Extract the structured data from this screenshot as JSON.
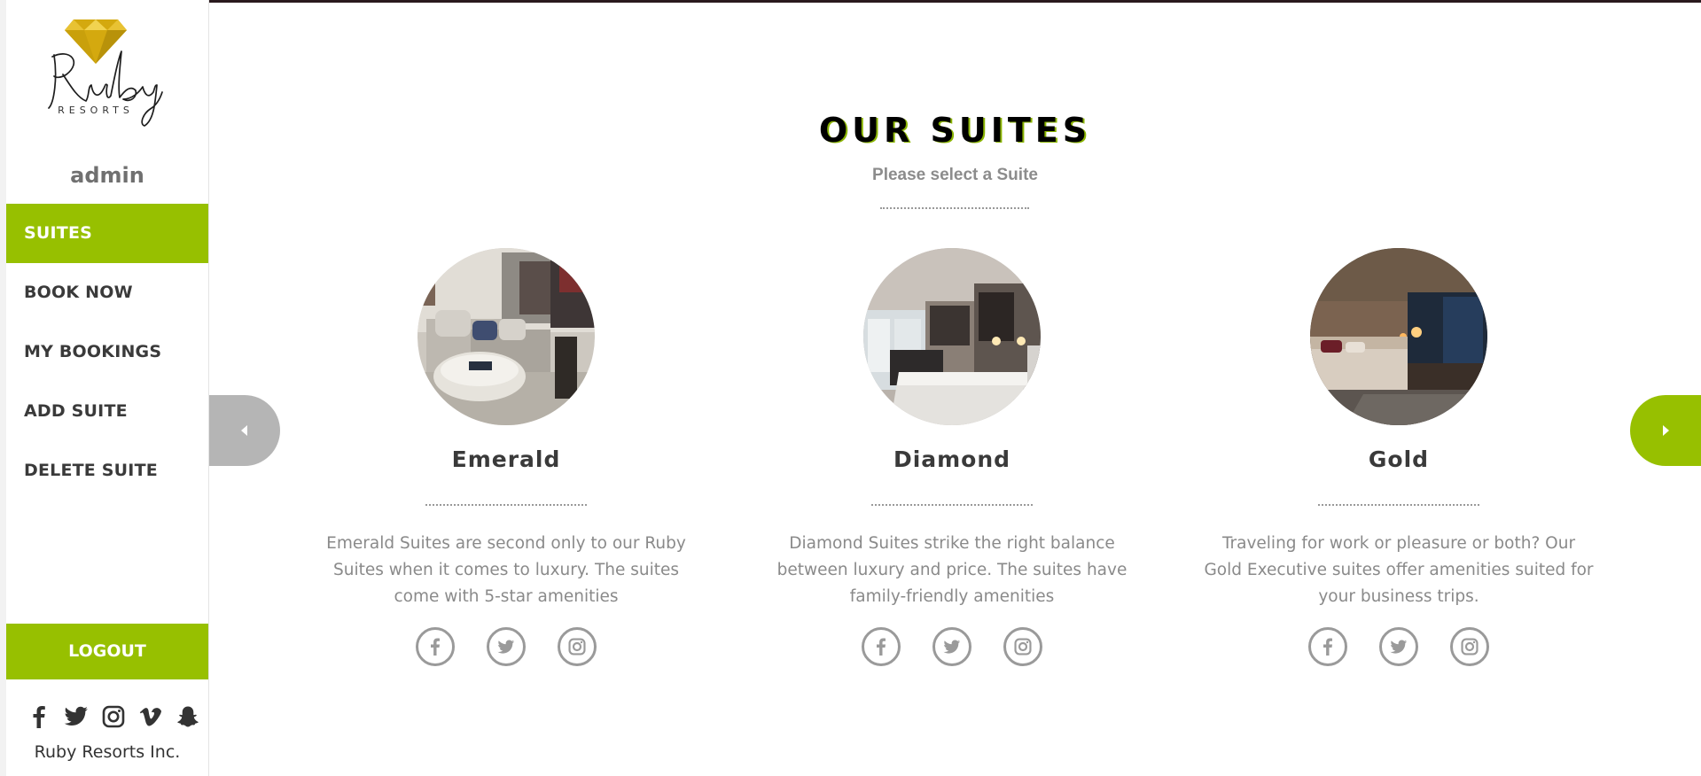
{
  "brand": {
    "logo_script": "Ruby",
    "logo_sub": "RESORTS",
    "accent_color": "#97c000",
    "gem_color": "#d4a90f"
  },
  "sidebar": {
    "username": "admin",
    "nav": [
      {
        "label": "SUITES",
        "active": true
      },
      {
        "label": "BOOK NOW",
        "active": false
      },
      {
        "label": "MY BOOKINGS",
        "active": false
      },
      {
        "label": "ADD SUITE",
        "active": false
      },
      {
        "label": "DELETE SUITE",
        "active": false
      }
    ],
    "logout_label": "LOGOUT",
    "social_icons": [
      "facebook-icon",
      "twitter-icon",
      "instagram-icon",
      "vimeo-icon",
      "snapchat-icon"
    ],
    "copyright": "Ruby Resorts Inc."
  },
  "main": {
    "title": "OUR SUITES",
    "subtitle": "Please select a Suite",
    "carousel": {
      "prev_icon": "caret-left-icon",
      "next_icon": "caret-right-icon"
    },
    "suites": [
      {
        "name": "Emerald",
        "description": "Emerald Suites are second only to our Ruby Suites when it comes to luxury. The suites come with 5-star amenities",
        "photo": "living-room-photo",
        "social_icons": [
          "facebook-icon",
          "twitter-icon",
          "instagram-icon"
        ]
      },
      {
        "name": "Diamond",
        "description": "Diamond Suites strike the right balance between luxury and price. The suites have family-friendly amenities",
        "photo": "bedroom-photo",
        "social_icons": [
          "facebook-icon",
          "twitter-icon",
          "instagram-icon"
        ]
      },
      {
        "name": "Gold",
        "description": "Traveling for work or pleasure or both? Our Gold Executive suites offer amenities suited for your business trips.",
        "photo": "executive-room-photo",
        "social_icons": [
          "facebook-icon",
          "twitter-icon",
          "instagram-icon"
        ]
      }
    ]
  }
}
